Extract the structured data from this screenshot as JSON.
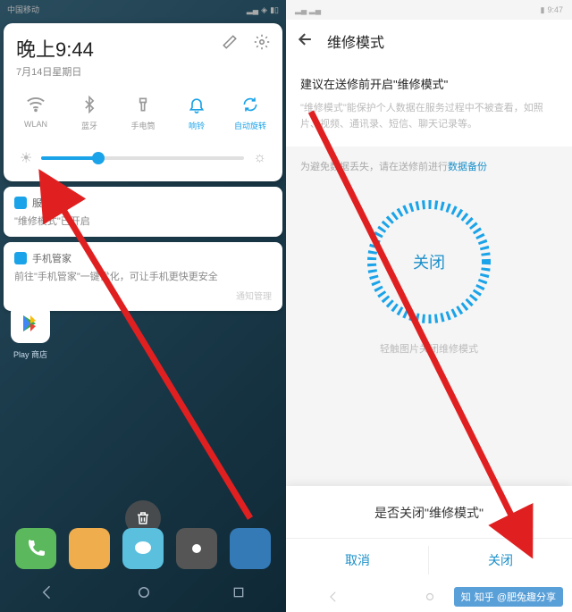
{
  "left": {
    "statusbar": {
      "carrier1": "中国移动",
      "carrier2": "中国移动"
    },
    "shade": {
      "time": "晚上9:44",
      "date": "7月14日星期日",
      "qs": [
        {
          "label": "WLAN",
          "active": false
        },
        {
          "label": "蓝牙",
          "active": false
        },
        {
          "label": "手电筒",
          "active": false
        },
        {
          "label": "响铃",
          "active": true
        },
        {
          "label": "自动旋转",
          "active": true
        }
      ]
    },
    "notifs": [
      {
        "app": "服务",
        "body": "\"维修模式\"已开启",
        "color": "#1aa3e8"
      },
      {
        "app": "手机管家",
        "body": "前往\"手机管家\"一键优化，可让手机更快更安全",
        "color": "#1aa3e8"
      }
    ],
    "notif_mgmt": "通知管理",
    "play_label": "Play 商店"
  },
  "right": {
    "statusbar_time": "9:47",
    "title": "维修模式",
    "heading": "建议在送修前开启\"维修模式\"",
    "desc": "\"维修模式\"能保护个人数据在服务过程中不被查看，如照片、视频、通讯录、短信、聊天记录等。",
    "backup_prefix": "为避免数据丢失，请在送修前进行",
    "backup_link": "数据备份",
    "circle_label": "关闭",
    "circle_hint": "轻触图片关闭维修模式",
    "dialog": {
      "message": "是否关闭\"维修模式\"",
      "cancel": "取消",
      "confirm": "关闭"
    }
  },
  "watermark": "知乎 @肥兔趣分享"
}
